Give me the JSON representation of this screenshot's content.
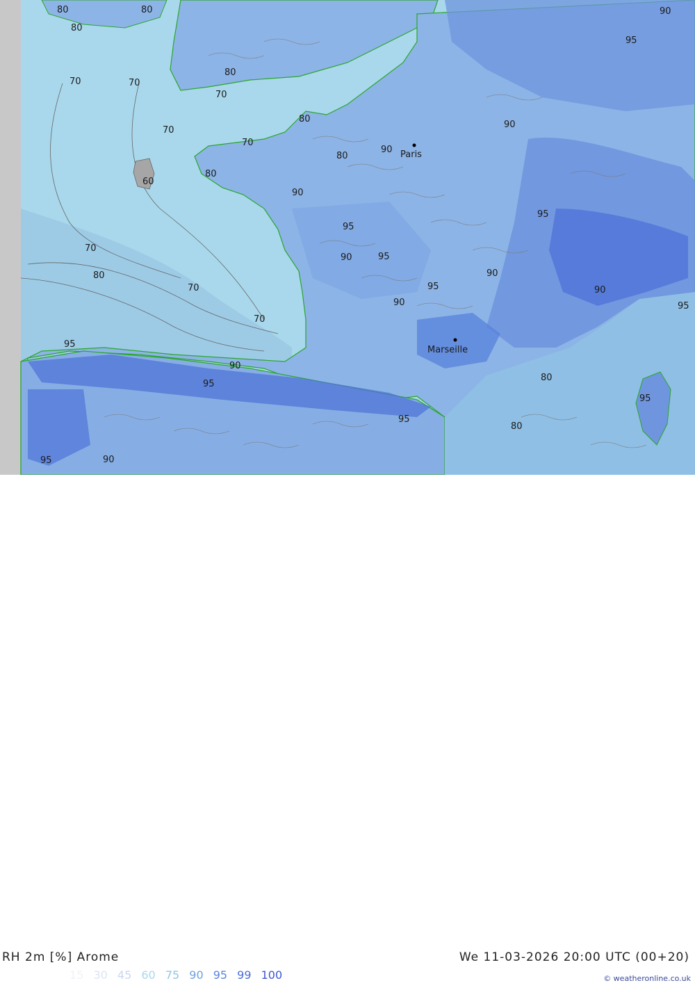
{
  "map": {
    "cities": [
      {
        "name": "Paris"
      },
      {
        "name": "Marseille",
        "display": "Marseille"
      }
    ],
    "contour_labels": [
      {
        "v": "80"
      },
      {
        "v": "80"
      },
      {
        "v": "80"
      },
      {
        "v": "80"
      },
      {
        "v": "80"
      },
      {
        "v": "80"
      },
      {
        "v": "80"
      },
      {
        "v": "80"
      },
      {
        "v": "70"
      },
      {
        "v": "70"
      },
      {
        "v": "70"
      },
      {
        "v": "70"
      },
      {
        "v": "70"
      },
      {
        "v": "70"
      },
      {
        "v": "70"
      },
      {
        "v": "70"
      },
      {
        "v": "60"
      },
      {
        "v": "90"
      },
      {
        "v": "90"
      },
      {
        "v": "90"
      },
      {
        "v": "90"
      },
      {
        "v": "90"
      },
      {
        "v": "90"
      },
      {
        "v": "90"
      },
      {
        "v": "95"
      },
      {
        "v": "95"
      },
      {
        "v": "95"
      },
      {
        "v": "95"
      },
      {
        "v": "95"
      },
      {
        "v": "95"
      },
      {
        "v": "95"
      },
      {
        "v": "95"
      },
      {
        "v": "90"
      },
      {
        "v": "90"
      },
      {
        "v": "95"
      },
      {
        "v": "95"
      },
      {
        "v": "80"
      },
      {
        "v": "80"
      },
      {
        "v": "90"
      },
      {
        "v": "95"
      }
    ]
  },
  "footer": {
    "title": "RH 2m [%] Arome",
    "datetime": "We 11-03-2026 20:00 UTC (00+20)",
    "copyright": "© weatheronline.co.uk",
    "legend": [
      {
        "label": "15",
        "color": "#eef2fa"
      },
      {
        "label": "30",
        "color": "#dce4f4"
      },
      {
        "label": "45",
        "color": "#c9d6ef"
      },
      {
        "label": "60",
        "color": "#a9d8ee"
      },
      {
        "label": "75",
        "color": "#8fc6e8"
      },
      {
        "label": "90",
        "color": "#6f9fe0"
      },
      {
        "label": "95",
        "color": "#5a84dc"
      },
      {
        "label": "99",
        "color": "#4a6ed8"
      },
      {
        "label": "100",
        "color": "#3a56d4"
      }
    ]
  },
  "colors": {
    "sea": "#a9d8ec",
    "land": "#8db4e6",
    "humid": "#6f95de",
    "very_humid": "#4f74d8",
    "coast": "#2aa52a",
    "contour": "#666666"
  }
}
